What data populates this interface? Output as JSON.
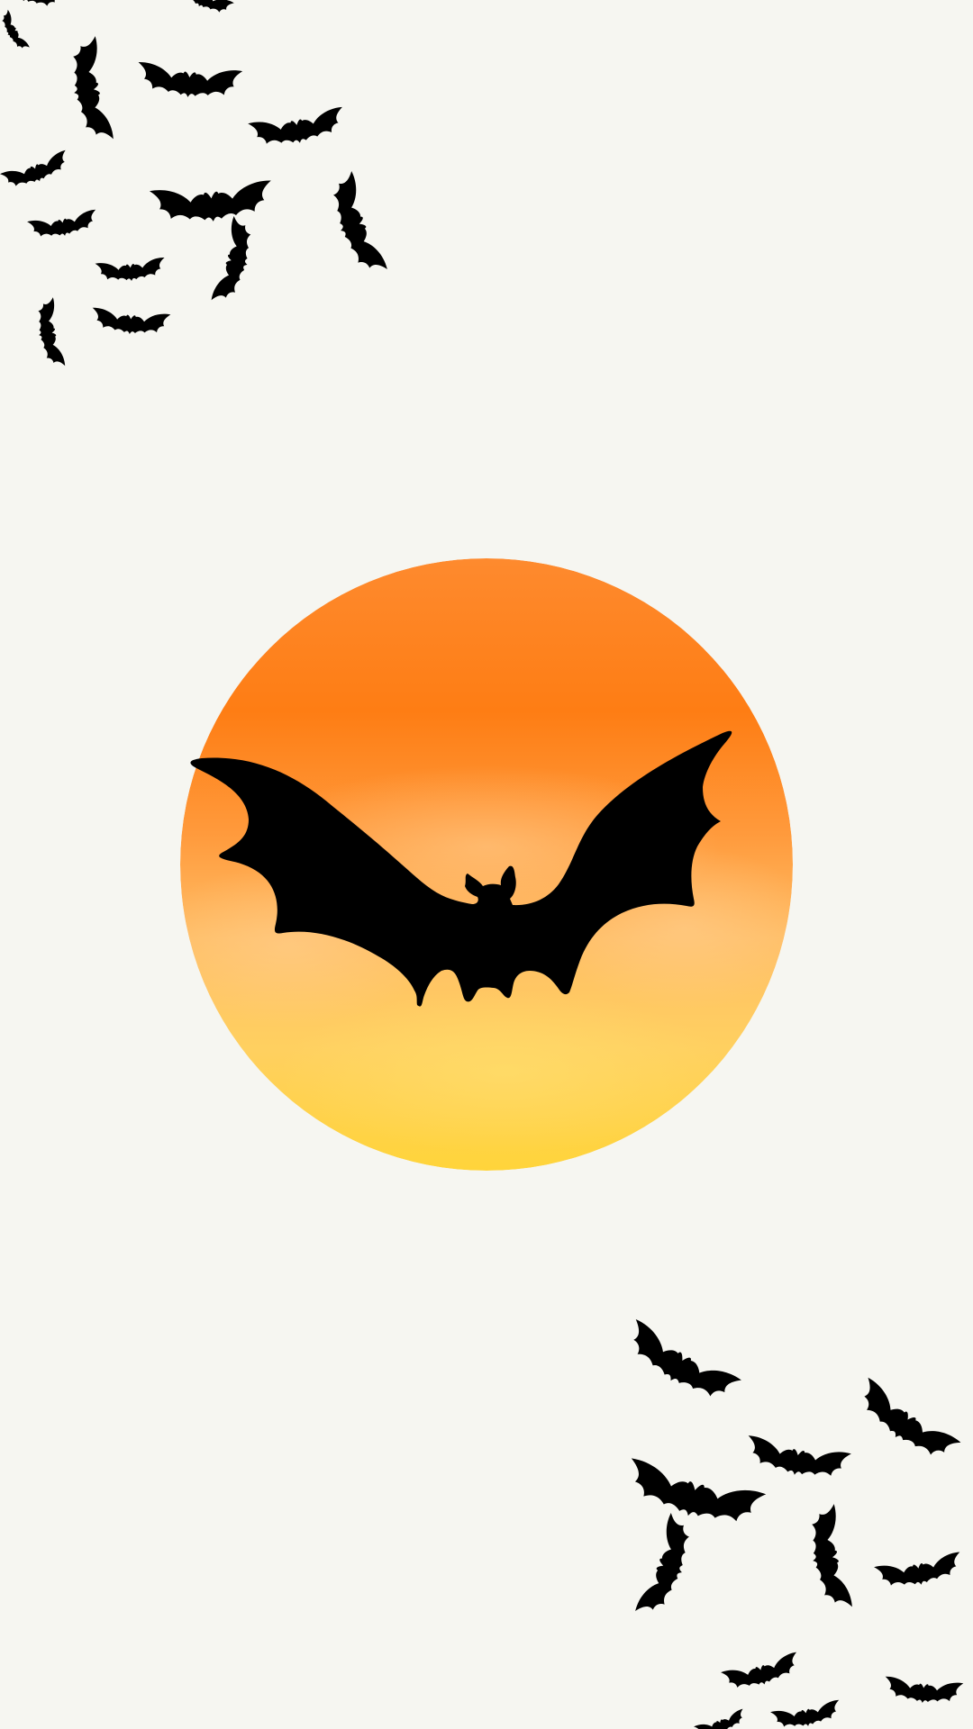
{
  "scene": {
    "subject": "bat-silhouette-over-moon",
    "colors": {
      "background": "#f6f6f1",
      "bat": "#000000",
      "moon_top": "#fe7d14",
      "moon_middle": "#ffb25a",
      "moon_bottom": "#ffd43a"
    },
    "icons": [
      "bat-icon",
      "moon-icon"
    ]
  }
}
